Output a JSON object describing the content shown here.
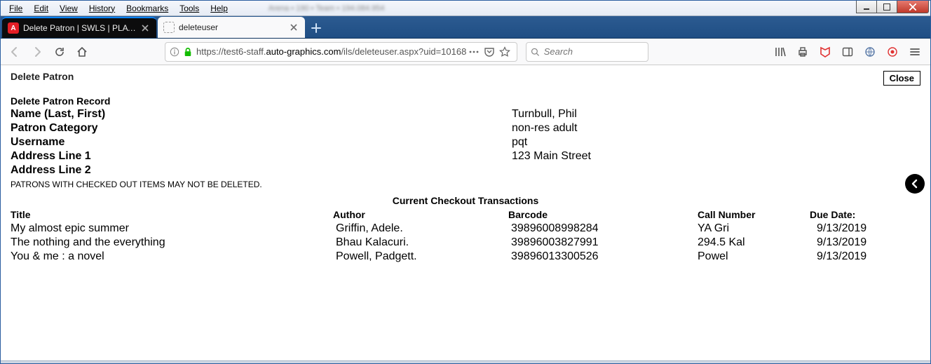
{
  "menu": {
    "items": [
      "File",
      "Edit",
      "View",
      "History",
      "Bookmarks",
      "Tools",
      "Help"
    ]
  },
  "tabs": [
    {
      "title": "Delete Patron | SWLS | PLATT | ",
      "fav": "A"
    },
    {
      "title": "deleteuser",
      "fav": ""
    }
  ],
  "url": {
    "pre": "https://test6-staff.",
    "strong": "auto-graphics.com",
    "post": "/ils/deleteuser.aspx?uid=10168"
  },
  "search": {
    "placeholder": "Search"
  },
  "page": {
    "title": "Delete Patron",
    "close_label": "Close",
    "record_header": "Delete Patron Record",
    "fields": [
      {
        "label": "Name (Last, First)",
        "value": "Turnbull, Phil"
      },
      {
        "label": "Patron Category",
        "value": "non-res adult"
      },
      {
        "label": "Username",
        "value": "pqt"
      },
      {
        "label": "Address Line 1",
        "value": "123 Main Street"
      },
      {
        "label": "Address Line 2",
        "value": ""
      }
    ],
    "warning": "PATRONS WITH CHECKED OUT ITEMS MAY NOT BE DELETED.",
    "table_title": "Current Checkout Transactions",
    "columns": [
      "Title",
      "Author",
      "Barcode",
      "Call Number",
      "Due Date:"
    ],
    "rows": [
      {
        "title": "My almost epic summer",
        "author": "Griffin, Adele.",
        "barcode": "39896008998284",
        "call": "YA Gri",
        "due": "9/13/2019"
      },
      {
        "title": "The nothing and the everything",
        "author": "Bhau Kalacuri.",
        "barcode": "39896003827991",
        "call": "294.5 Kal",
        "due": "9/13/2019"
      },
      {
        "title": "You & me : a novel",
        "author": "Powell, Padgett.",
        "barcode": "39896013300526",
        "call": "Powel",
        "due": "9/13/2019"
      }
    ]
  }
}
